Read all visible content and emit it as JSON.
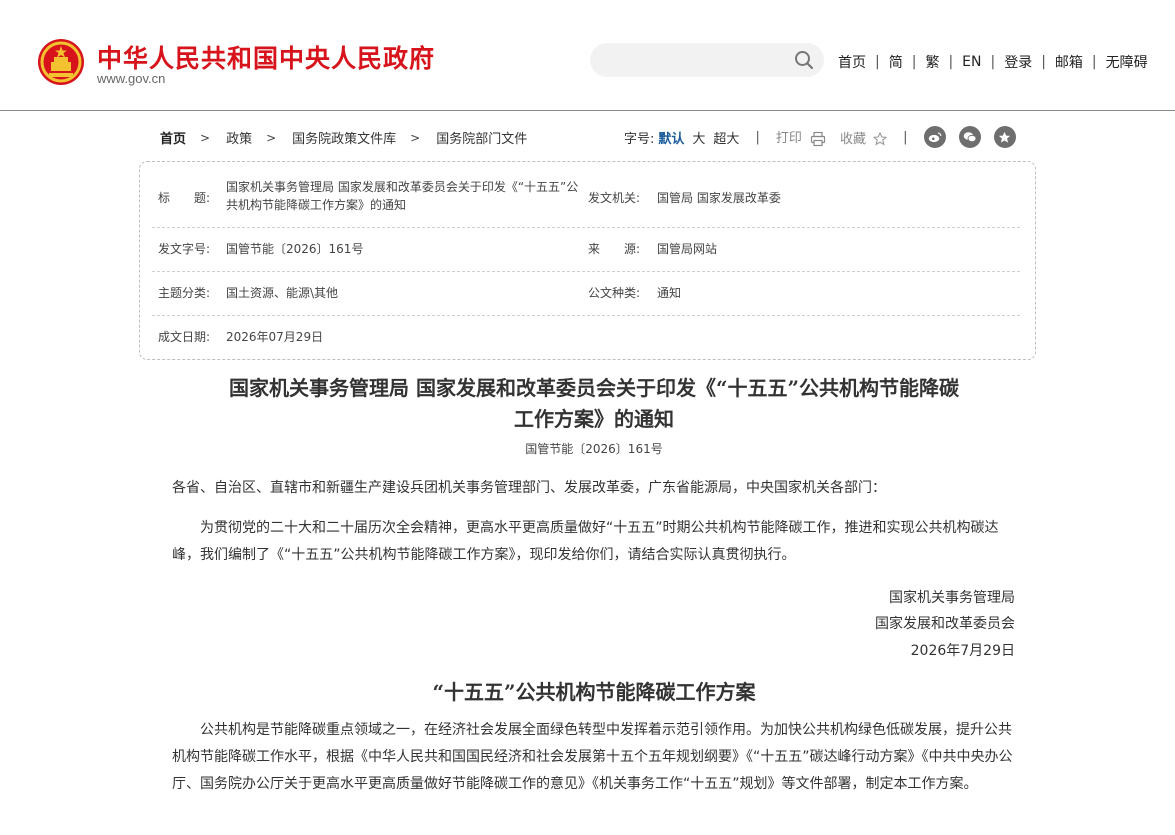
{
  "header": {
    "site_name": "中华人民共和国中央人民政府",
    "site_url": "www.gov.cn",
    "nav": [
      "首页",
      "简",
      "繁",
      "EN",
      "登录",
      "邮箱",
      "无障碍"
    ]
  },
  "breadcrumb": [
    "首页",
    "政策",
    "国务院政策文件库",
    "国务院部门文件"
  ],
  "tools": {
    "font_label": "字号:",
    "font_default": "默认",
    "font_large": "大",
    "font_xlarge": "超大",
    "print": "打印",
    "favorite": "收藏"
  },
  "info": {
    "title_key": "标　　题:",
    "title_val": "国家机关事务管理局 国家发展和改革委员会关于印发《“十五五”公共机构节能降碳工作方案》的通知",
    "issuer_key": "发文机关:",
    "issuer_val": "国管局 国家发展改革委",
    "docno_key": "发文字号:",
    "docno_val": "国管节能〔2026〕161号",
    "source_key": "来　　源:",
    "source_val": "国管局网站",
    "topic_key": "主题分类:",
    "topic_val": "国土资源、能源\\其他",
    "type_key": "公文种类:",
    "type_val": "通知",
    "date_key": "成文日期:",
    "date_val": "2026年07月29日"
  },
  "article": {
    "title_line1": "国家机关事务管理局 国家发展和改革委员会关于印发《“十五五”公共机构节能降碳",
    "title_line2": "工作方案》的通知",
    "doc_no": "国管节能〔2026〕161号",
    "addressee": "各省、自治区、直辖市和新疆生产建设兵团机关事务管理部门、发展改革委，广东省能源局，中央国家机关各部门：",
    "body_p1": "为贯彻党的二十大和二十届历次全会精神，更高水平更高质量做好“十五五”时期公共机构节能降碳工作，推进和实现公共机构碳达峰，我们编制了《“十五五”公共机构节能降碳工作方案》，现印发给你们，请结合实际认真贯彻执行。",
    "sign_org1": "国家机关事务管理局",
    "sign_org2": "国家发展和改革委员会",
    "sign_date": "2026年7月29日",
    "subtitle": "“十五五”公共机构节能降碳工作方案",
    "body_p2": "公共机构是节能降碳重点领域之一，在经济社会发展全面绿色转型中发挥着示范引领作用。为加快公共机构绿色低碳发展，提升公共机构节能降碳工作水平，根据《中华人民共和国国民经济和社会发展第十五个五年规划纲要》《“十五五”碳达峰行动方案》《中共中央办公厅、国务院办公厅关于更高水平更高质量做好节能降碳工作的意见》《机关事务工作“十五五”规划》等文件部署，制定本工作方案。"
  },
  "colors": {
    "brand_red": "#d7141b",
    "link_blue": "#1a5b99"
  },
  "icons": [
    "national-emblem-icon",
    "search-icon",
    "print-icon",
    "star-icon",
    "weibo-icon",
    "wechat-icon",
    "favorite-star-icon"
  ]
}
